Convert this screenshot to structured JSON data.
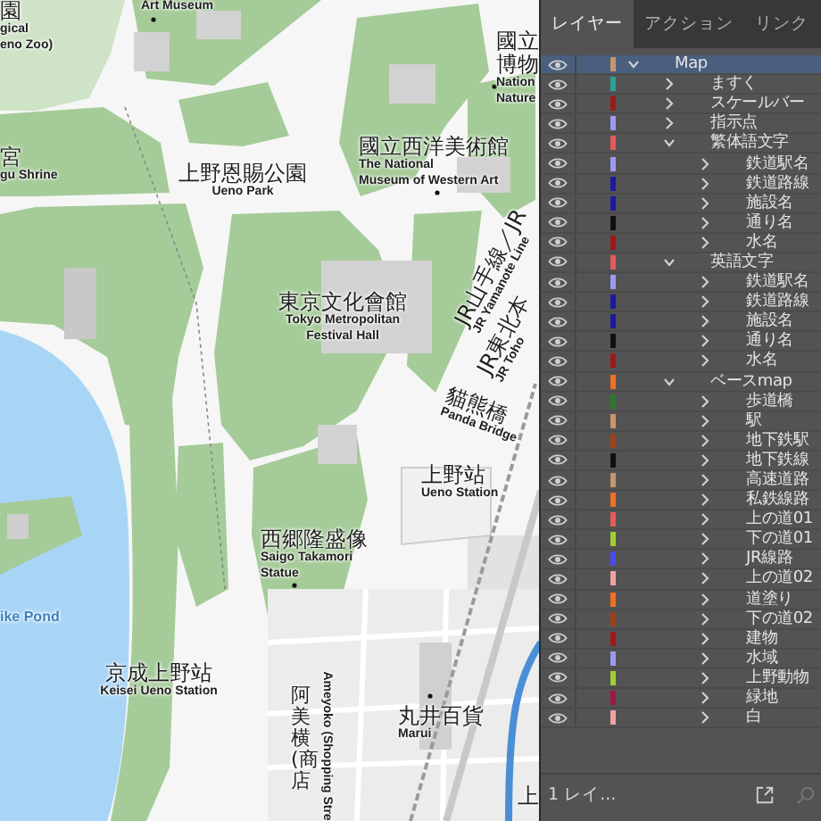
{
  "map_labels": [
    {
      "kind": "horizontal",
      "ja": [
        "園"
      ],
      "en": [
        "gical",
        "eno Zoo)"
      ]
    },
    {
      "kind": "horizontal",
      "en": [
        "Art Museum"
      ]
    },
    {
      "kind": "horizontal",
      "ja": [
        "國立",
        "博物"
      ],
      "en": [
        "Nation",
        "Nature"
      ]
    },
    {
      "kind": "horizontal",
      "ja": [
        "宮"
      ],
      "en": [
        "gu Shrine"
      ]
    },
    {
      "kind": "horizontal",
      "ja": [
        "上野恩賜公園"
      ],
      "en": [
        "Ueno Park"
      ]
    },
    {
      "kind": "horizontal",
      "ja": [
        "國立西洋美術館"
      ],
      "en": [
        "The National",
        "Museum of Western Art"
      ]
    },
    {
      "kind": "horizontal",
      "ja": [
        "東京文化會館"
      ],
      "en": [
        "Tokyo Metropolitan",
        "Festival Hall"
      ]
    },
    {
      "kind": "rotated",
      "ja": [
        "JR山手線／JR"
      ],
      "en": [
        "JR Yamanote Line"
      ]
    },
    {
      "kind": "rotated",
      "ja": [
        "JR東北本"
      ],
      "en": [
        "JR Toho"
      ]
    },
    {
      "kind": "rotated",
      "ja": [
        "貓熊橋"
      ],
      "en": [
        "Panda Bridge"
      ]
    },
    {
      "kind": "horizontal",
      "ja": [
        "上野站"
      ],
      "en": [
        "Ueno Station"
      ]
    },
    {
      "kind": "horizontal",
      "ja": [
        "西郷隆盛像"
      ],
      "en": [
        "Saigo Takamori",
        "Statue"
      ]
    },
    {
      "kind": "water",
      "en": [
        "ike Pond"
      ]
    },
    {
      "kind": "horizontal",
      "ja": [
        "京成上野站"
      ],
      "en": [
        "Keisei Ueno Station"
      ]
    },
    {
      "kind": "vertical",
      "ja": [
        "阿美横(商店"
      ]
    },
    {
      "kind": "rotated",
      "en": [
        "Ameyoko (Shopping Stre"
      ]
    },
    {
      "kind": "horizontal",
      "ja": [
        "丸井百貨"
      ],
      "en": [
        "Marui"
      ]
    },
    {
      "kind": "horizontal",
      "ja": [
        "上"
      ]
    }
  ],
  "panel": {
    "tabs": [
      {
        "label": "レイヤー",
        "selected": true
      },
      {
        "label": "アクション",
        "selected": false
      },
      {
        "label": "リンク",
        "selected": false
      }
    ],
    "layers": [
      {
        "name": "Map",
        "color": "#c8956a",
        "visible": true,
        "expanded": true,
        "selected": true,
        "children": [
          {
            "name": "ますく",
            "color": "#2aa198",
            "visible": true,
            "expanded": false,
            "selected": false
          },
          {
            "name": "スケールバー",
            "color": "#a01818",
            "visible": true,
            "expanded": false,
            "selected": false
          },
          {
            "name": "指示点",
            "color": "#9a9af0",
            "visible": true,
            "expanded": false,
            "selected": false
          },
          {
            "name": "繁体語文字",
            "color": "#e85a5a",
            "visible": true,
            "expanded": true,
            "selected": false,
            "children": [
              {
                "name": "鉄道駅名",
                "color": "#9a9af0",
                "visible": true,
                "expanded": false,
                "selected": false
              },
              {
                "name": "鉄道路線",
                "color": "#1a1aa0",
                "visible": true,
                "expanded": false,
                "selected": false
              },
              {
                "name": "施設名",
                "color": "#1a1aa0",
                "visible": true,
                "expanded": false,
                "selected": false
              },
              {
                "name": "通り名",
                "color": "#111111",
                "visible": true,
                "expanded": false,
                "selected": false
              },
              {
                "name": "水名",
                "color": "#a01818",
                "visible": true,
                "expanded": false,
                "selected": false
              }
            ]
          },
          {
            "name": "英語文字",
            "color": "#e85a5a",
            "visible": true,
            "expanded": true,
            "selected": false,
            "children": [
              {
                "name": "鉄道駅名",
                "color": "#9a9af0",
                "visible": true,
                "expanded": false,
                "selected": false
              },
              {
                "name": "鉄道路線",
                "color": "#1a1aa0",
                "visible": true,
                "expanded": false,
                "selected": false
              },
              {
                "name": "施設名",
                "color": "#1a1aa0",
                "visible": true,
                "expanded": false,
                "selected": false
              },
              {
                "name": "通り名",
                "color": "#111111",
                "visible": true,
                "expanded": false,
                "selected": false
              },
              {
                "name": "水名",
                "color": "#a01818",
                "visible": true,
                "expanded": false,
                "selected": false
              }
            ]
          },
          {
            "name": "ベースmap",
            "color": "#f07020",
            "visible": true,
            "expanded": true,
            "selected": false,
            "children": [
              {
                "name": "歩道橋",
                "color": "#2a7a2a",
                "visible": true,
                "expanded": false,
                "selected": false
              },
              {
                "name": "駅",
                "color": "#c8956a",
                "visible": true,
                "expanded": false,
                "selected": false
              },
              {
                "name": "地下鉄駅",
                "color": "#a0401a",
                "visible": true,
                "expanded": false,
                "selected": false
              },
              {
                "name": "地下鉄線",
                "color": "#111111",
                "visible": true,
                "expanded": false,
                "selected": false
              },
              {
                "name": "高速道路",
                "color": "#c8956a",
                "visible": true,
                "expanded": false,
                "selected": false
              },
              {
                "name": "私鉄線路",
                "color": "#f07020",
                "visible": true,
                "expanded": false,
                "selected": false
              },
              {
                "name": "上の道01",
                "color": "#e85a5a",
                "visible": true,
                "expanded": false,
                "selected": false
              },
              {
                "name": "下の道01",
                "color": "#a0d030",
                "visible": true,
                "expanded": false,
                "selected": false
              },
              {
                "name": "JR線路",
                "color": "#4a4af0",
                "visible": true,
                "expanded": false,
                "selected": false
              },
              {
                "name": "上の道02",
                "color": "#f0a0a0",
                "visible": true,
                "expanded": false,
                "selected": false
              },
              {
                "name": "道塗り",
                "color": "#f07020",
                "visible": true,
                "expanded": false,
                "selected": false
              },
              {
                "name": "下の道02",
                "color": "#a0401a",
                "visible": true,
                "expanded": false,
                "selected": false
              },
              {
                "name": "建物",
                "color": "#a01818",
                "visible": true,
                "expanded": false,
                "selected": false
              },
              {
                "name": "水域",
                "color": "#9a9af0",
                "visible": true,
                "expanded": false,
                "selected": false
              },
              {
                "name": "上野動物",
                "color": "#a0d030",
                "visible": true,
                "expanded": false,
                "selected": false
              },
              {
                "name": "緑地",
                "color": "#a01840",
                "visible": true,
                "expanded": false,
                "selected": false
              },
              {
                "name": "白",
                "color": "#f0a0a0",
                "visible": true,
                "expanded": false,
                "selected": false
              }
            ]
          }
        ]
      }
    ],
    "footer": {
      "count": "1 レイ..."
    }
  }
}
